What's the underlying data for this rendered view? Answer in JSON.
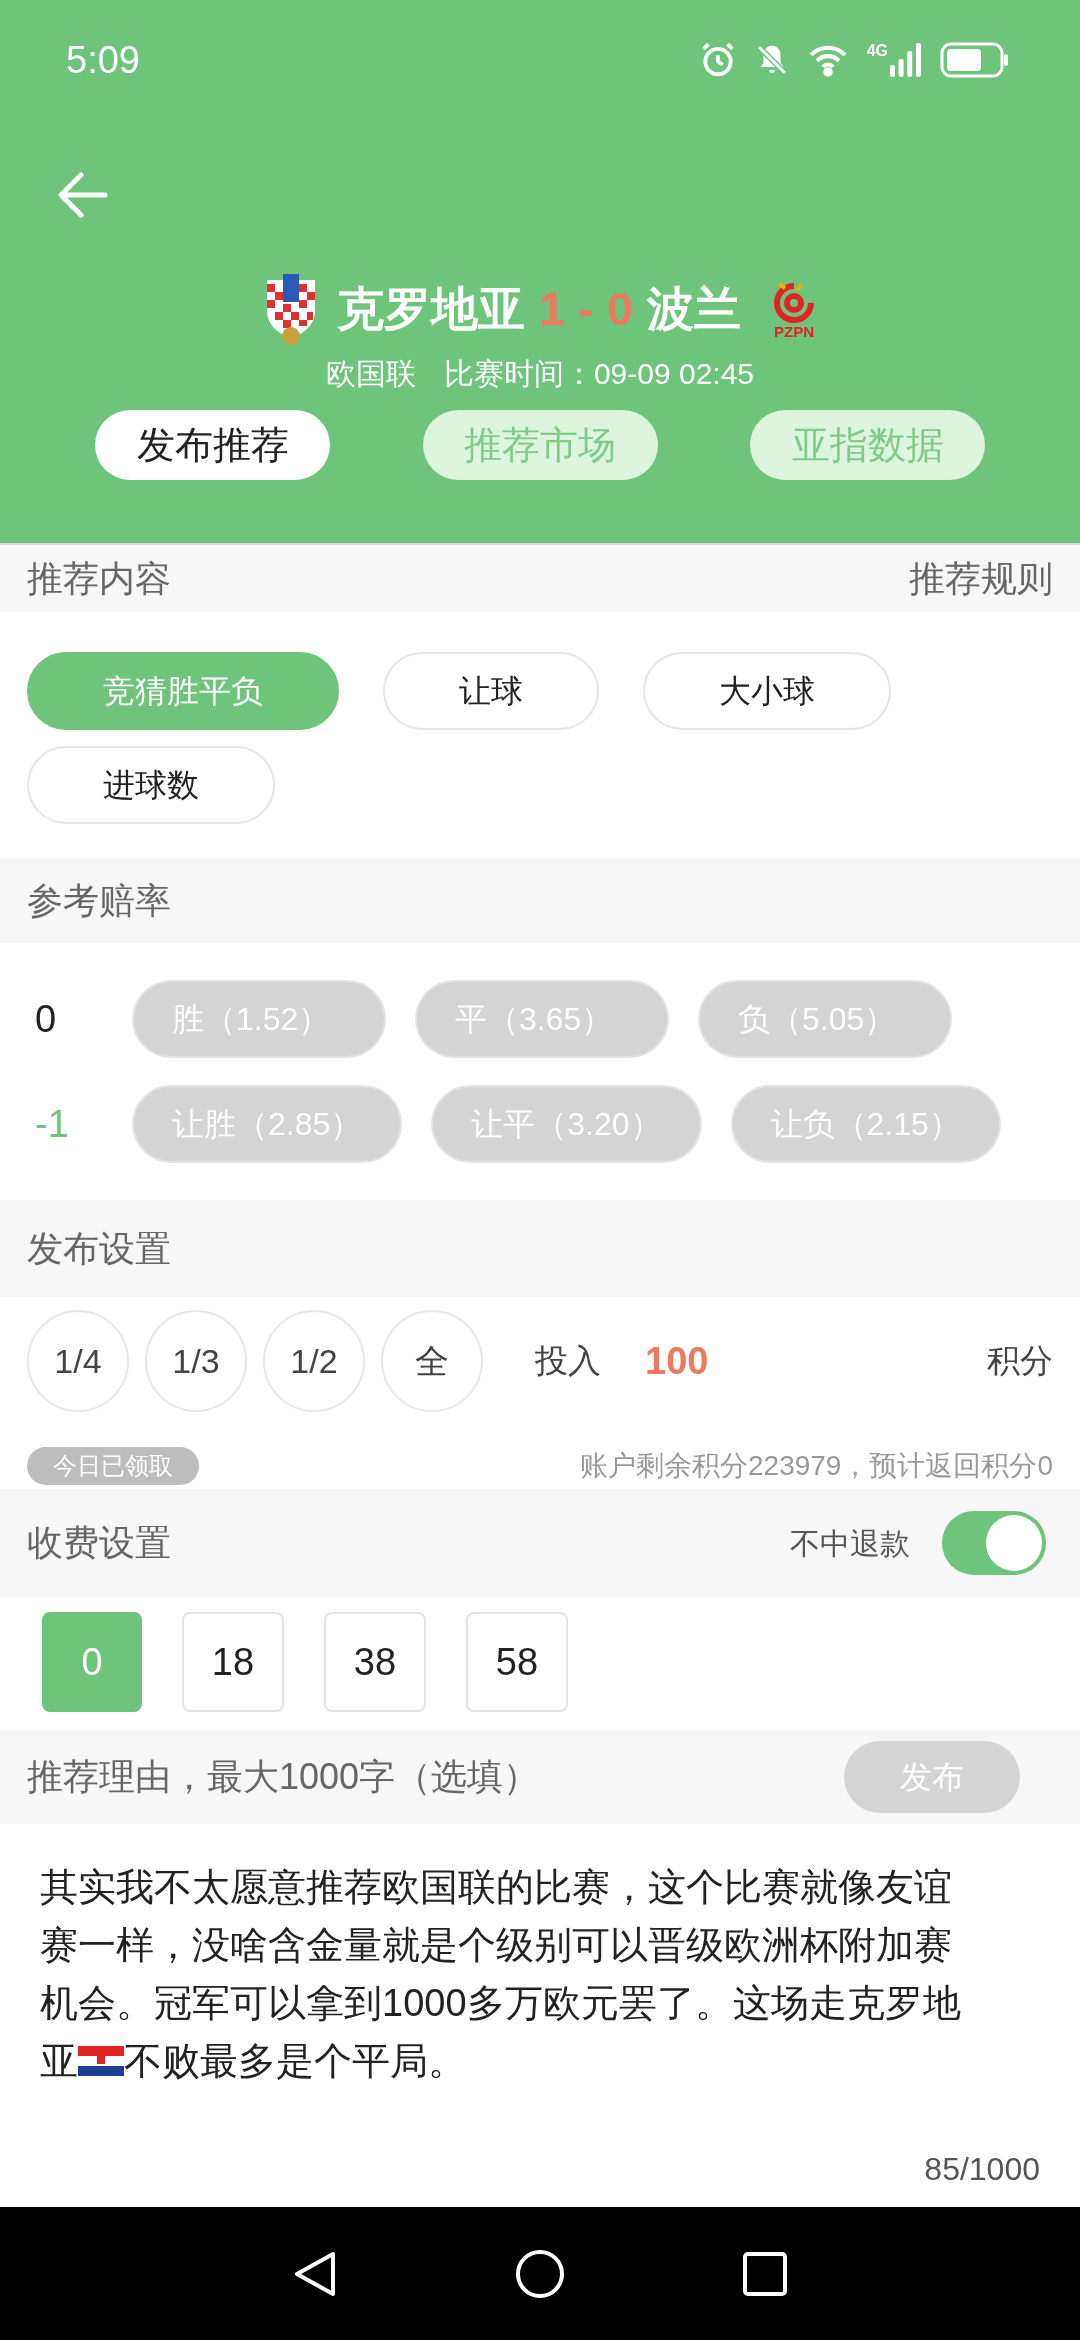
{
  "status_bar": {
    "time": "5:09",
    "network": "4G"
  },
  "header": {
    "home_team": "克罗地亚",
    "score": "1 - 0",
    "away_team": "波兰",
    "away_crest_text": "PZPN",
    "league": "欧国联",
    "match_time": "比赛时间：09-09 02:45"
  },
  "tabs": [
    {
      "label": "发布推荐",
      "selected": true
    },
    {
      "label": "推荐市场",
      "selected": false
    },
    {
      "label": "亚指数据",
      "selected": false
    }
  ],
  "content_section": {
    "title": "推荐内容",
    "link": "推荐规则",
    "options": [
      {
        "label": "竞猜胜平负",
        "selected": true
      },
      {
        "label": "让球",
        "selected": false
      },
      {
        "label": "大小球",
        "selected": false
      },
      {
        "label": "进球数",
        "selected": false
      }
    ]
  },
  "odds_section": {
    "title": "参考赔率",
    "rows": [
      {
        "handicap": "0",
        "kind": "plain",
        "odds": [
          {
            "label": "胜（1.52）",
            "selected": false
          },
          {
            "label": "平（3.65）",
            "selected": false
          },
          {
            "label": "负（5.05）",
            "selected": false
          }
        ]
      },
      {
        "handicap": "-1",
        "kind": "handicap",
        "odds": [
          {
            "label": "让胜（2.85）",
            "selected": false
          },
          {
            "label": "让平（3.20）",
            "selected": false
          },
          {
            "label": "让负（2.15）",
            "selected": false
          }
        ]
      }
    ]
  },
  "publish_settings": {
    "title": "发布设置",
    "fractions": [
      {
        "label": "1/4",
        "selected": false
      },
      {
        "label": "1/3",
        "selected": false
      },
      {
        "label": "1/2",
        "selected": false
      },
      {
        "label": "全",
        "selected": false
      }
    ],
    "stake_label": "投入",
    "stake": "100",
    "unit": "积分",
    "badge": "今日已领取",
    "balance": "账户剩余积分223979，预计返回积分0"
  },
  "fee_settings": {
    "title": "收费设置",
    "refund_label": "不中退款",
    "refund_on": true,
    "fees": [
      {
        "label": "0",
        "selected": true
      },
      {
        "label": "18",
        "selected": false
      },
      {
        "label": "38",
        "selected": false
      },
      {
        "label": "58",
        "selected": false
      }
    ]
  },
  "reason": {
    "title": "推荐理由，最大1000字（选填）",
    "publish_button": {
      "label": "发布",
      "disabled": true
    },
    "lines": [
      "其实我不太愿意推荐欧国联的比赛，这个比赛就像友谊",
      "赛一样，没啥含金量就是个级别可以晋级欧洲杯附加赛",
      "机会。冠军可以拿到1000多万欧元罢了。这场走克罗地"
    ],
    "text_before_flag": "亚",
    "text_after_flag": "不败最多是个平局。",
    "counter": "85/1000"
  }
}
